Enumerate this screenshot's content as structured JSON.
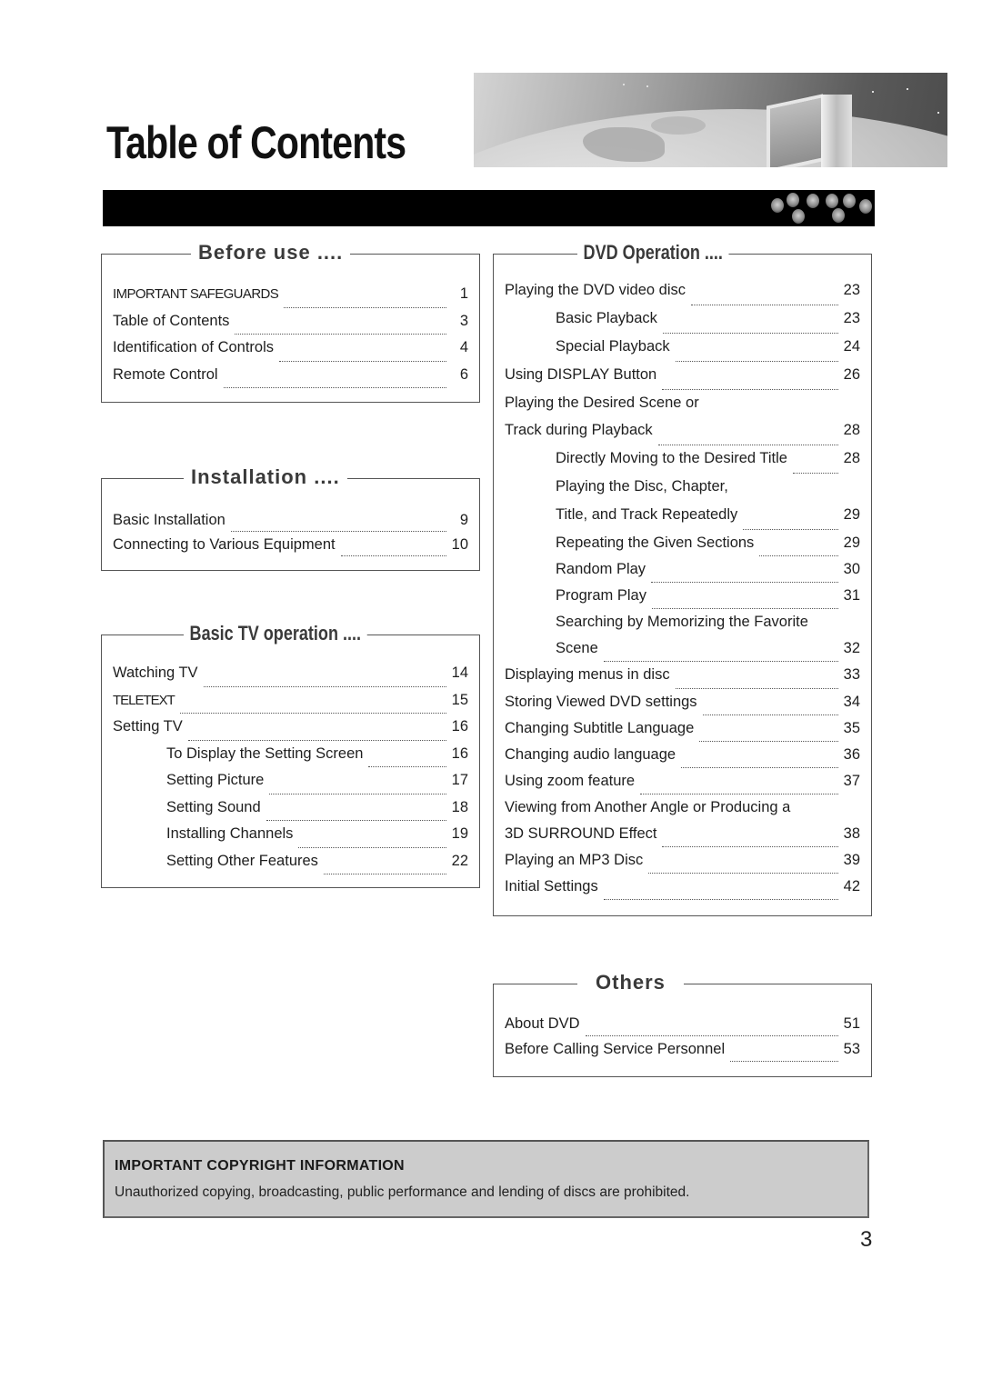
{
  "header": {
    "title": "Table of Contents"
  },
  "sections": {
    "before_use": {
      "title": "Before use ....",
      "items": [
        {
          "label": "IMPORTANT SAFEGUARDS",
          "page": "1"
        },
        {
          "label": "Table of Contents",
          "page": "3"
        },
        {
          "label": "Identification of Controls",
          "page": "4"
        },
        {
          "label": "Remote Control",
          "page": "6"
        }
      ]
    },
    "installation": {
      "title": "Installation ....",
      "items": [
        {
          "label": "Basic Installation",
          "page": "9"
        },
        {
          "label": "Connecting to Various Equipment",
          "page": "10"
        }
      ]
    },
    "basic_tv": {
      "title": "Basic TV operation ....",
      "items": [
        {
          "label": "Watching TV",
          "page": "14"
        },
        {
          "label": "TELETEXT",
          "page": "15"
        },
        {
          "label": "Setting TV",
          "page": "16"
        },
        {
          "label": "To Display the Setting Screen",
          "page": "16"
        },
        {
          "label": "Setting Picture",
          "page": "17"
        },
        {
          "label": "Setting Sound",
          "page": "18"
        },
        {
          "label": "Installing Channels",
          "page": "19"
        },
        {
          "label": "Setting Other Features",
          "page": "22"
        }
      ]
    },
    "dvd_operation": {
      "title": "DVD Operation ....",
      "items": [
        {
          "label": "Playing the DVD video disc",
          "page": "23"
        },
        {
          "label": "Basic Playback",
          "page": "23"
        },
        {
          "label": "Special Playback",
          "page": "24"
        },
        {
          "label": "Using DISPLAY Button",
          "page": "26"
        },
        {
          "label": "Playing the Desired Scene or",
          "page": ""
        },
        {
          "label": "Track during Playback",
          "page": "28"
        },
        {
          "label": "Directly Moving to the Desired Title",
          "page": "28"
        },
        {
          "label": "Playing the Disc, Chapter,",
          "page": ""
        },
        {
          "label": "Title, and Track Repeatedly",
          "page": "29"
        },
        {
          "label": "Repeating the Given Sections",
          "page": "29"
        },
        {
          "label": "Random Play",
          "page": "30"
        },
        {
          "label": "Program Play",
          "page": "31"
        },
        {
          "label": "Searching by Memorizing the Favorite",
          "page": ""
        },
        {
          "label": "Scene",
          "page": "32"
        },
        {
          "label": "Displaying menus in disc",
          "page": "33"
        },
        {
          "label": "Storing Viewed DVD settings",
          "page": "34"
        },
        {
          "label": "Changing Subtitle Language",
          "page": "35"
        },
        {
          "label": "Changing audio language",
          "page": "36"
        },
        {
          "label": "Using zoom feature",
          "page": "37"
        },
        {
          "label": "Viewing from Another Angle or Producing a",
          "page": ""
        },
        {
          "label": "3D SURROUND Effect",
          "page": "38"
        },
        {
          "label": "Playing an MP3 Disc",
          "page": "39"
        },
        {
          "label": "Initial Settings",
          "page": "42"
        }
      ]
    },
    "others": {
      "title": "Others",
      "items": [
        {
          "label": "About DVD",
          "page": "51"
        },
        {
          "label": "Before Calling Service Personnel",
          "page": "53"
        }
      ]
    }
  },
  "copyright": {
    "title": "IMPORTANT COPYRIGHT INFORMATION",
    "text": "Unauthorized copying, broadcasting, public performance and lending of discs are prohibited."
  },
  "footer": {
    "page_number": "3"
  }
}
